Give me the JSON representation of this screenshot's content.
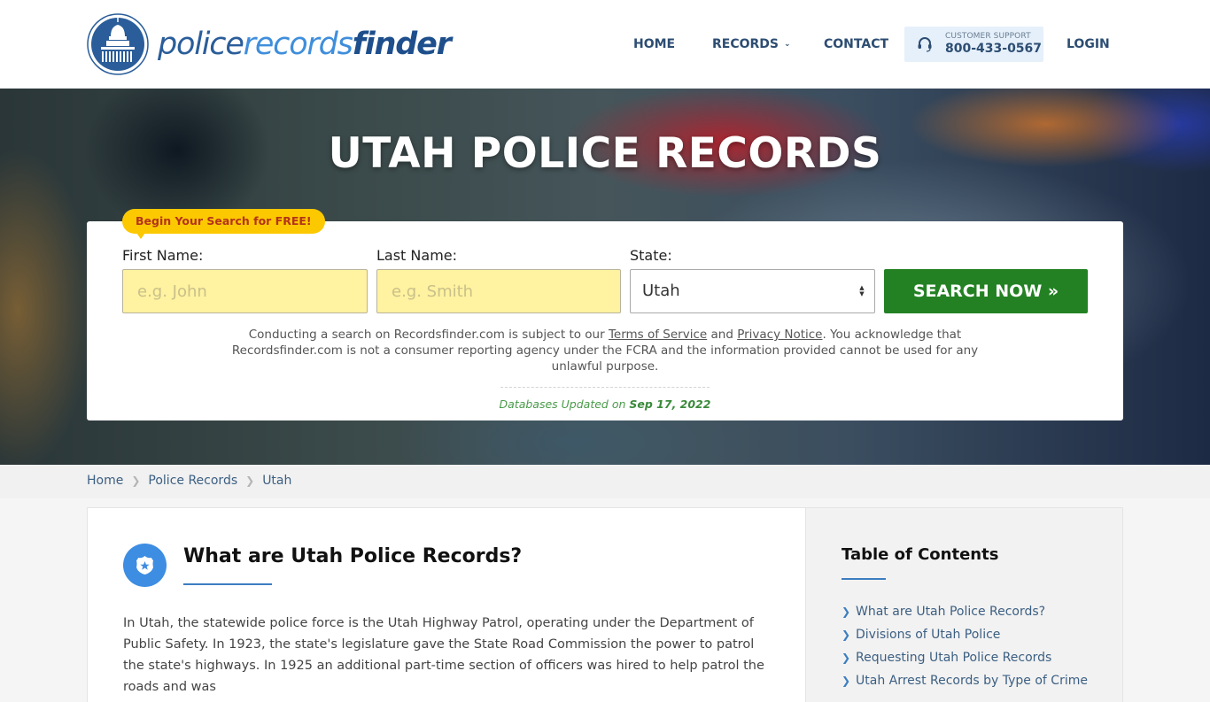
{
  "header": {
    "logo": {
      "part1": "police",
      "part2": "records",
      "part3": "finder"
    },
    "nav": [
      {
        "label": "HOME"
      },
      {
        "label": "RECORDS",
        "has_dropdown": true
      },
      {
        "label": "CONTACT"
      }
    ],
    "support": {
      "label": "CUSTOMER SUPPORT",
      "phone": "800-433-0567",
      "icon": "headset-icon"
    },
    "login_label": "LOGIN"
  },
  "hero": {
    "title": "UTAH POLICE RECORDS",
    "badge": "Begin Your Search for FREE!",
    "form": {
      "first_name_label": "First Name:",
      "first_name_placeholder": "e.g. John",
      "first_name_value": "",
      "last_name_label": "Last Name:",
      "last_name_placeholder": "e.g. Smith",
      "last_name_value": "",
      "state_label": "State:",
      "state_value": "Utah",
      "search_button": "SEARCH NOW",
      "search_button_icon": "double-chevron-right-icon"
    },
    "disclaimer": {
      "part1": "Conducting a search on Recordsfinder.com is subject to our ",
      "terms_link": "Terms of Service",
      "part2": " and ",
      "privacy_link": "Privacy Notice",
      "part3": ". You acknowledge that Recordsfinder.com is not a consumer reporting agency under the FCRA and the information provided cannot be used for any unlawful purpose."
    },
    "db_updated": {
      "label": "Databases Updated on ",
      "date": "Sep 17, 2022"
    }
  },
  "breadcrumb": [
    {
      "label": "Home"
    },
    {
      "label": "Police Records"
    },
    {
      "label": "Utah"
    }
  ],
  "article": {
    "icon": "police-badge-icon",
    "title": "What are Utah Police Records?",
    "body": "In Utah, the statewide police force is the Utah Highway Patrol, operating under the Department of Public Safety. In 1923, the state's legislature gave the State Road Commission the power to patrol the state's highways. In 1925 an additional part-time section of officers was hired to help patrol the roads and was"
  },
  "toc": {
    "title": "Table of Contents",
    "items": [
      {
        "label": "What are Utah Police Records?"
      },
      {
        "label": "Divisions of Utah Police"
      },
      {
        "label": "Requesting Utah Police Records"
      },
      {
        "label": "Utah Arrest Records by Type of Crime"
      }
    ]
  },
  "colors": {
    "brand_blue": "#2a5d9a",
    "accent_blue": "#3d8de2",
    "search_green": "#238123",
    "badge_yellow": "#fcc800",
    "input_yellow": "#fff2a0"
  }
}
